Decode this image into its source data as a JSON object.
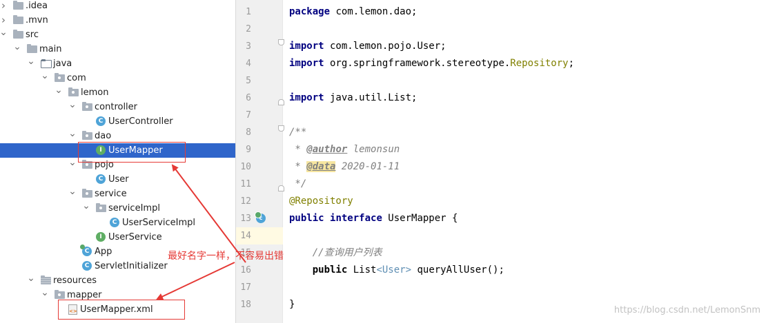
{
  "tree": [
    {
      "label": ".idea",
      "type": "folder",
      "expand": "right",
      "depth": 0
    },
    {
      "label": ".mvn",
      "type": "folder",
      "expand": "right",
      "depth": 0
    },
    {
      "label": "src",
      "type": "folder",
      "expand": "down",
      "depth": 0
    },
    {
      "label": "main",
      "type": "folder",
      "expand": "down",
      "depth": 1
    },
    {
      "label": "java",
      "type": "srcfolder",
      "expand": "down",
      "depth": 2
    },
    {
      "label": "com",
      "type": "package",
      "expand": "down",
      "depth": 3
    },
    {
      "label": "lemon",
      "type": "package",
      "expand": "down",
      "depth": 4
    },
    {
      "label": "controller",
      "type": "package",
      "expand": "down",
      "depth": 5
    },
    {
      "label": "UserController",
      "type": "class",
      "depth": 6
    },
    {
      "label": "dao",
      "type": "package",
      "expand": "down",
      "depth": 5
    },
    {
      "label": "UserMapper",
      "type": "interface",
      "depth": 6,
      "selected": true
    },
    {
      "label": "pojo",
      "type": "package",
      "expand": "down",
      "depth": 5
    },
    {
      "label": "User",
      "type": "class",
      "depth": 6
    },
    {
      "label": "service",
      "type": "package",
      "expand": "down",
      "depth": 5
    },
    {
      "label": "serviceImpl",
      "type": "package",
      "expand": "down",
      "depth": 6
    },
    {
      "label": "UserServiceImpl",
      "type": "class",
      "depth": 7
    },
    {
      "label": "UserService",
      "type": "interface",
      "depth": 6
    },
    {
      "label": "App",
      "type": "app",
      "depth": 5
    },
    {
      "label": "ServletInitializer",
      "type": "class",
      "depth": 5
    },
    {
      "label": "resources",
      "type": "resfolder",
      "expand": "down",
      "depth": 2
    },
    {
      "label": "mapper",
      "type": "package",
      "expand": "down",
      "depth": 3
    },
    {
      "label": "UserMapper.xml",
      "type": "xml",
      "depth": 4
    }
  ],
  "code_lines": [
    {
      "n": "1",
      "parts": [
        {
          "t": "package",
          "c": "kw"
        },
        {
          "t": " com.lemon.dao;",
          "c": ""
        }
      ]
    },
    {
      "n": "2",
      "parts": []
    },
    {
      "n": "3",
      "parts": [
        {
          "t": "import",
          "c": "kw"
        },
        {
          "t": " com.lemon.pojo.User;",
          "c": ""
        }
      ]
    },
    {
      "n": "4",
      "parts": [
        {
          "t": "import",
          "c": "kw"
        },
        {
          "t": " org.springframework.stereotype.",
          "c": ""
        },
        {
          "t": "Repository",
          "c": "ann"
        },
        {
          "t": ";",
          "c": ""
        }
      ]
    },
    {
      "n": "5",
      "parts": []
    },
    {
      "n": "6",
      "parts": [
        {
          "t": "import",
          "c": "kw"
        },
        {
          "t": " java.util.List;",
          "c": ""
        }
      ]
    },
    {
      "n": "7",
      "parts": []
    },
    {
      "n": "8",
      "parts": [
        {
          "t": "/**",
          "c": "cmt"
        }
      ]
    },
    {
      "n": "9",
      "parts": [
        {
          "t": " * ",
          "c": "cmt"
        },
        {
          "t": "@author",
          "c": "tag"
        },
        {
          "t": " lemonsun",
          "c": "cmt"
        }
      ]
    },
    {
      "n": "10",
      "parts": [
        {
          "t": " * ",
          "c": "cmt"
        },
        {
          "t": "@data",
          "c": "tag hl"
        },
        {
          "t": " 2020-01-11",
          "c": "cmt"
        }
      ]
    },
    {
      "n": "11",
      "parts": [
        {
          "t": " */",
          "c": "cmt"
        }
      ]
    },
    {
      "n": "12",
      "parts": [
        {
          "t": "@Repository",
          "c": "ann"
        }
      ]
    },
    {
      "n": "13",
      "parts": [
        {
          "t": "public",
          "c": "kw"
        },
        {
          "t": " ",
          "c": ""
        },
        {
          "t": "interface",
          "c": "kw"
        },
        {
          "t": " UserMapper {",
          "c": ""
        }
      ]
    },
    {
      "n": "14",
      "parts": []
    },
    {
      "n": "15",
      "parts": [
        {
          "t": "    //查询用户列表",
          "c": "cmt2"
        }
      ]
    },
    {
      "n": "16",
      "parts": [
        {
          "t": "    public",
          "c": "pub"
        },
        {
          "t": " List",
          "c": ""
        },
        {
          "t": "<User>",
          "c": "gen"
        },
        {
          "t": " queryAllUser();",
          "c": ""
        }
      ]
    },
    {
      "n": "17",
      "parts": []
    },
    {
      "n": "18",
      "parts": [
        {
          "t": "}",
          "c": ""
        }
      ]
    }
  ],
  "annotation": {
    "note": "最好名字一样，不容易出错",
    "color": "#e53935"
  },
  "watermark": "https://blog.csdn.net/LemonSnm",
  "colors": {
    "selection": "#2f65ca",
    "keyword": "#000080",
    "annotation": "#808000",
    "comment": "#808080",
    "caret_line": "#fffae3",
    "gutter": "#f0f0f0"
  },
  "icons": {
    "class": "class-c-icon",
    "interface": "interface-i-icon",
    "folder": "folder-icon",
    "xml": "xml-file-icon",
    "implementation_gutter": "implemented-interface-icon"
  }
}
